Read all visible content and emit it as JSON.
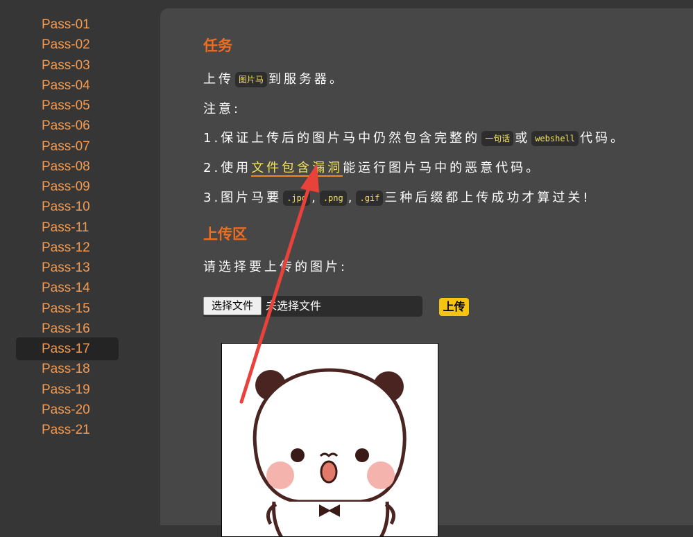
{
  "sidebar": {
    "items": [
      "Pass-01",
      "Pass-02",
      "Pass-03",
      "Pass-04",
      "Pass-05",
      "Pass-06",
      "Pass-07",
      "Pass-08",
      "Pass-09",
      "Pass-10",
      "Pass-11",
      "Pass-12",
      "Pass-13",
      "Pass-14",
      "Pass-15",
      "Pass-16",
      "Pass-17",
      "Pass-18",
      "Pass-19",
      "Pass-20",
      "Pass-21"
    ],
    "active": "Pass-17"
  },
  "task": {
    "heading": "任务",
    "line1_a": "上传",
    "line1_code": "图片马",
    "line1_b": "到服务器。",
    "note": "注意:",
    "item1_a": "1.保证上传后的图片马中仍然包含完整的",
    "item1_code1": "一句话",
    "item1_mid": "或",
    "item1_code2": "webshell",
    "item1_b": "代码。",
    "item2_a": "2.使用",
    "item2_link": "文件包含漏洞",
    "item2_b": "能运行图片马中的恶意代码。",
    "item3_a": "3.图片马要",
    "item3_code1": ".jpg",
    "item3_sep1": ",",
    "item3_code2": ".png",
    "item3_sep2": ",",
    "item3_code3": ".gif",
    "item3_b": "三种后缀都上传成功才算过关!"
  },
  "upload": {
    "heading": "上传区",
    "prompt": "请选择要上传的图片:",
    "choose_label": "选择文件",
    "no_file_label": "未选择文件",
    "upload_label": "上传"
  },
  "colors": {
    "accent": "#ef6d1f",
    "nav": "#f59a4e",
    "code_text": "#f2e45f",
    "upload_btn": "#f5c40e",
    "arrow": "#e8423a"
  },
  "icons": {
    "preview": "panda-sticker-image",
    "annotation": "red-arrow"
  }
}
